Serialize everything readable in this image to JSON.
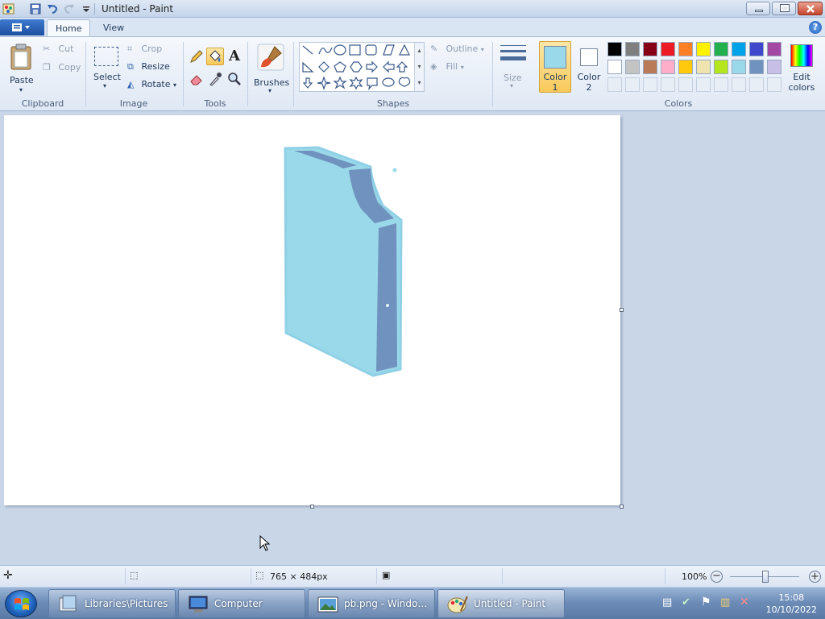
{
  "window": {
    "title": "Untitled - Paint"
  },
  "tabs": [
    {
      "label": "Home"
    },
    {
      "label": "View"
    }
  ],
  "clipboard": {
    "paste": "Paste",
    "cut": "Cut",
    "copy": "Copy",
    "group": "Clipboard"
  },
  "image": {
    "select": "Select",
    "crop": "Crop",
    "resize": "Resize",
    "rotate": "Rotate",
    "group": "Image"
  },
  "tools": {
    "group": "Tools",
    "selected": "fill-icon"
  },
  "brushes": {
    "label": "Brushes"
  },
  "shapes": {
    "group": "Shapes",
    "outline": "Outline",
    "fill": "Fill"
  },
  "size": {
    "label": "Size"
  },
  "colors": {
    "group": "Colors",
    "color1_label_a": "Color",
    "color1_label_b": "1",
    "color2_label_a": "Color",
    "color2_label_b": "2",
    "color1": "#99d9ea",
    "color2": "#ffffff",
    "edit_label_a": "Edit",
    "edit_label_b": "colors",
    "palette_row1": [
      "#000000",
      "#7f7f7f",
      "#880015",
      "#ed1c24",
      "#ff7f27",
      "#fff200",
      "#22b14c",
      "#00a2e8",
      "#3f48cc",
      "#a349a4"
    ],
    "palette_row2": [
      "#ffffff",
      "#c3c3c3",
      "#b97a57",
      "#ffaec9",
      "#ffc90e",
      "#efe4b0",
      "#b5e61d",
      "#99d9ea",
      "#7092be",
      "#c8bfe7"
    ]
  },
  "canvas": {
    "background": "#ffffff",
    "shape_fill": "#99d9ea",
    "shape_dark": "#7092be"
  },
  "status": {
    "dimensions": "765 × 484px",
    "zoom": "100%"
  },
  "taskbar": {
    "items": [
      {
        "label": "Libraries\\Pictures"
      },
      {
        "label": "Computer"
      },
      {
        "label": "pb.png - Window..."
      },
      {
        "label": "Untitled - Paint"
      }
    ],
    "time": "15:08",
    "date": "10/10/2022"
  }
}
